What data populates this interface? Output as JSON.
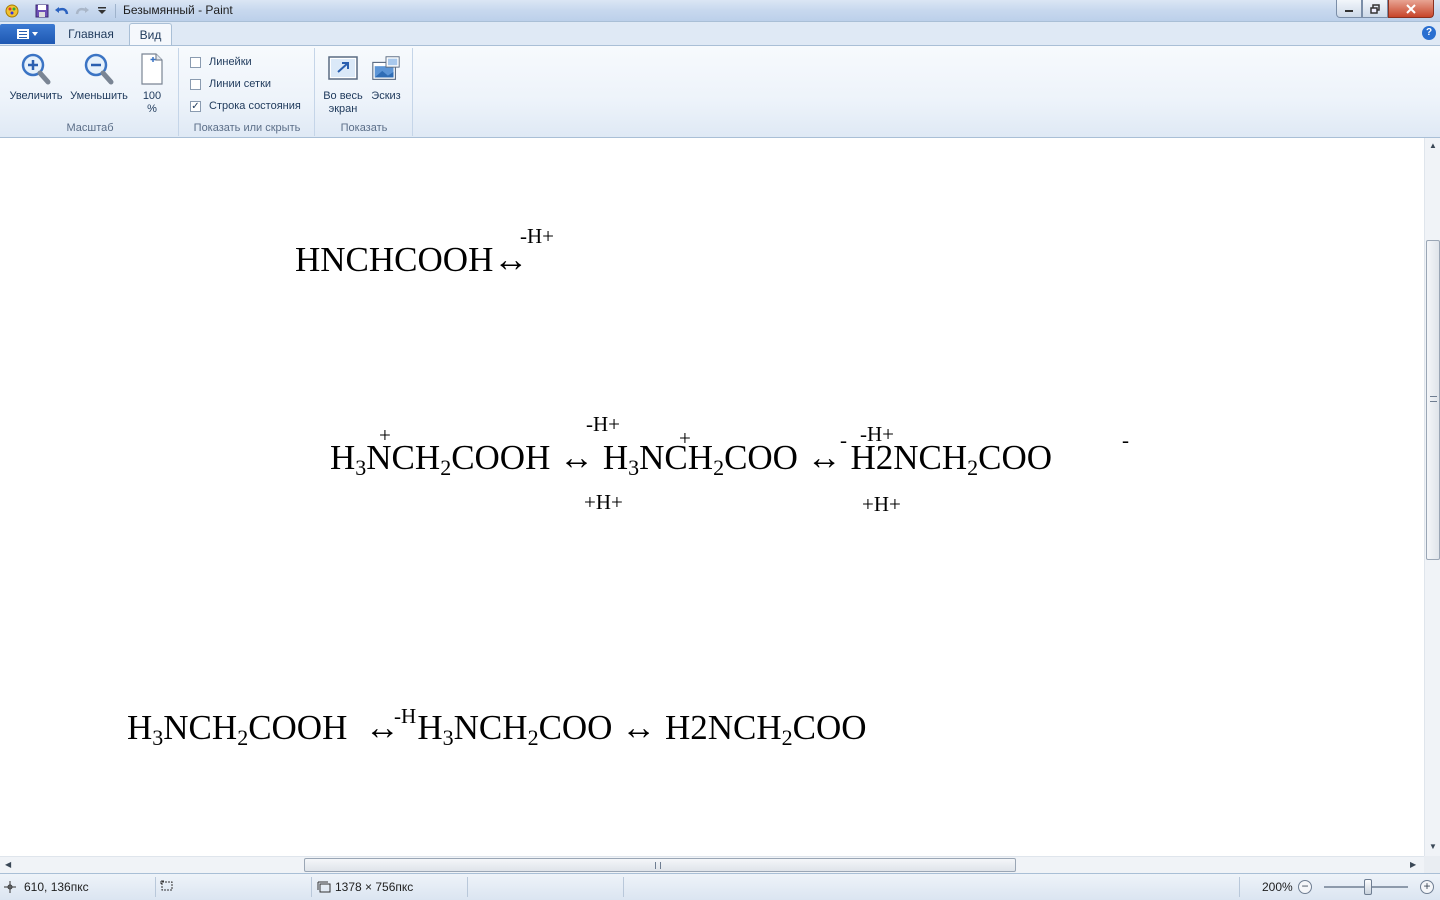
{
  "window": {
    "title": "Безымянный - Paint"
  },
  "tabs": [
    {
      "label": "Главная",
      "active": false
    },
    {
      "label": "Вид",
      "active": true
    }
  ],
  "help_label": "?",
  "ribbon": {
    "zoom_group": {
      "label": "Масштаб",
      "zoom_in": "Увеличить",
      "zoom_out": "Уменьшить",
      "hundred_line1": "100",
      "hundred_line2": "%"
    },
    "show_hide_group": {
      "label": "Показать или скрыть",
      "rulers": {
        "label": "Линейки",
        "checked": false
      },
      "gridlines": {
        "label": "Линии сетки",
        "checked": false
      },
      "statusbar": {
        "label": "Строка состояния",
        "checked": true
      }
    },
    "display_group": {
      "label": "Показать",
      "fullscreen_line1": "Во весь",
      "fullscreen_line2": "экран",
      "thumbnail": "Эскиз"
    }
  },
  "canvas": {
    "formula1": {
      "text": "HNCHCOOH↔",
      "above": "-H+"
    },
    "formula2": {
      "part1": "H",
      "sub1": "3",
      "part2": "NCH",
      "sub2": "2",
      "part3": "COOH",
      "arrow1": "↔",
      "part4": "H",
      "sub3": "3",
      "part5": "NCH",
      "sub4": "2",
      "part6": "COO",
      "arrow2": "↔",
      "part7": "H2NCH",
      "sub5": "2",
      "part8": "COO",
      "plus1": "+",
      "plus2": "+",
      "minus1": "-",
      "minus2": "-",
      "above1": "-H+",
      "below1": "+H+",
      "above2": "-H+",
      "below2": "+H+"
    },
    "formula3": {
      "part1": "H",
      "sub1": "3",
      "part2": "NCH",
      "sub2": "2",
      "part3": "COOH",
      "arrow1": "↔",
      "arrow_label": "-H",
      "part4": "H",
      "sub3": "3",
      "part5": "NCH",
      "sub4": "2",
      "part6": "COO",
      "arrow2": "↔",
      "part7": "H2NCH",
      "sub5": "2",
      "part8": "COO"
    }
  },
  "status": {
    "cursor_pos": "610, 136пкс",
    "image_size": "1378 × 756пкс",
    "zoom": "200%",
    "zoom_fraction": 0.52
  }
}
